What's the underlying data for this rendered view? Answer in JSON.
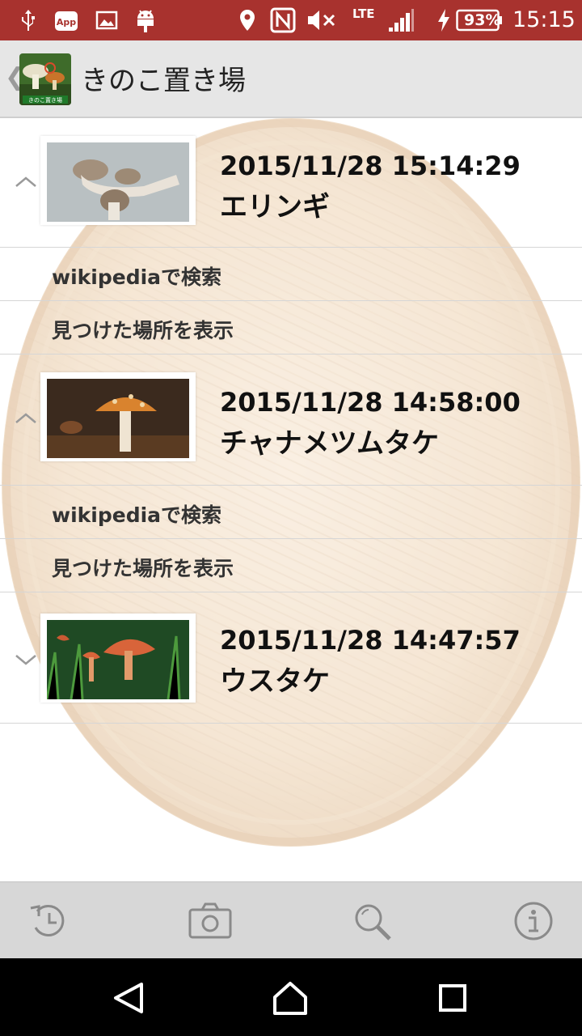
{
  "status_bar": {
    "battery": "93%",
    "network": "LTE",
    "time": "15:15",
    "app_badge": "App",
    "icons": [
      "usb-icon",
      "app-notification-icon",
      "image-notification-icon",
      "android-icon",
      "location-icon",
      "nfc-icon",
      "mute-icon",
      "signal-icon",
      "charging-icon",
      "battery-icon"
    ]
  },
  "action_bar": {
    "title": "きのこ置き場",
    "logo_caption": "きのこ置き場"
  },
  "entries": [
    {
      "date": "2015/11/28 15:14:29",
      "name": "エリンギ",
      "expanded": true,
      "actions": [
        "wikipediaで検索",
        "見つけた場所を表示"
      ]
    },
    {
      "date": "2015/11/28 14:58:00",
      "name": "チャナメツムタケ",
      "expanded": true,
      "actions": [
        "wikipediaで検索",
        "見つけた場所を表示"
      ]
    },
    {
      "date": "2015/11/28 14:47:57",
      "name": "ウスタケ",
      "expanded": false,
      "actions": []
    }
  ],
  "toolbar": {
    "icons": [
      "history-icon",
      "camera-icon",
      "search-icon",
      "info-icon"
    ]
  },
  "nav_bar": {
    "icons": [
      "back-icon",
      "home-icon",
      "recents-icon"
    ]
  },
  "colors": {
    "status_bar": "#a8322e",
    "action_bar": "#e6e6e6",
    "toolbar": "#d7d7d7",
    "nav_bar": "#000000"
  }
}
